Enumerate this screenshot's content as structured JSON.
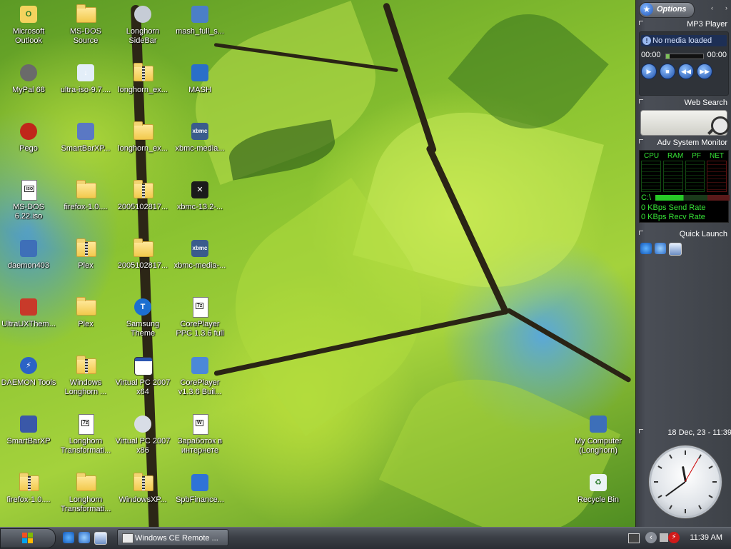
{
  "desktop_icons": [
    {
      "label": "Microsoft Outlook",
      "icon": "outlook-icon"
    },
    {
      "label": "MS-DOS Source",
      "icon": "folder-icon"
    },
    {
      "label": "Longhorn SideBar",
      "icon": "cd-icon"
    },
    {
      "label": "mash_full_s...",
      "icon": "computer-icon"
    },
    {
      "label": "MyPal 68",
      "icon": "raccoon-icon"
    },
    {
      "label": "ultra-iso-9.7....",
      "icon": "installer-icon"
    },
    {
      "label": "longhorn_ex...",
      "icon": "zip-folder-icon"
    },
    {
      "label": "MASH",
      "icon": "mash-icon"
    },
    {
      "label": "Pego",
      "icon": "red-ball-icon"
    },
    {
      "label": "SmartBarXP...",
      "icon": "smartbar-installer-icon"
    },
    {
      "label": "longhorn_ex...",
      "icon": "folder-icon"
    },
    {
      "label": "xbmc-media...",
      "icon": "xbmc-icon"
    },
    {
      "label": "MS-DOS 6.22.iso",
      "icon": "iso-icon"
    },
    {
      "label": "firefox-1.0....",
      "icon": "folder-icon"
    },
    {
      "label": "2005102817...",
      "icon": "zip-folder-icon"
    },
    {
      "label": "xbmc-13.2-...",
      "icon": "xbmc-x-icon"
    },
    {
      "label": "daemon403",
      "icon": "daemon-installer-icon"
    },
    {
      "label": "Plex",
      "icon": "zip-folder-icon"
    },
    {
      "label": "2005102817...",
      "icon": "folder-icon"
    },
    {
      "label": "xbmc-media-...",
      "icon": "xbmc-icon"
    },
    {
      "label": "UltraUXThem...",
      "icon": "ultraux-icon"
    },
    {
      "label": "Plex",
      "icon": "folder-icon"
    },
    {
      "label": "Samsung Theme",
      "icon": "samsung-theme-icon"
    },
    {
      "label": "CorePlayer PPC 1.3.6 full",
      "icon": "7z-icon"
    },
    {
      "label": "DAEMON Tools",
      "icon": "daemon-tools-icon"
    },
    {
      "label": "Windows Longhorn ...",
      "icon": "zip-folder-icon"
    },
    {
      "label": "Virtual PC 2007 x64",
      "icon": "window-icon"
    },
    {
      "label": "CorePlayer v1.3.6 Buil...",
      "icon": "coreplayer-installer-icon"
    },
    {
      "label": "SmartBarXP",
      "icon": "smartbar-icon"
    },
    {
      "label": "Longhorn Transformati...",
      "icon": "7z-icon"
    },
    {
      "label": "Virtual PC 2007 x86",
      "icon": "disc-icon"
    },
    {
      "label": "Заработок в интернете",
      "icon": "word-doc-icon"
    },
    {
      "label": "firefox-1.0....",
      "icon": "zip-folder-icon"
    },
    {
      "label": "Longhorn Transformati...",
      "icon": "folder-icon"
    },
    {
      "label": "WindowsXP...",
      "icon": "zip-folder-icon"
    },
    {
      "label": "SpbFinance...",
      "icon": "spb-installer-icon"
    }
  ],
  "right_icons": [
    {
      "label": "My Computer (Longhorn)",
      "icon": "my-computer-icon"
    },
    {
      "label": "Recycle Bin",
      "icon": "recycle-bin-icon"
    }
  ],
  "sidebar": {
    "options_label": "Options",
    "mp3": {
      "title": "MP3 Player",
      "status": "No media loaded",
      "time_elapsed": "00:00",
      "time_total": "00:00",
      "progress": 0.1
    },
    "search": {
      "title": "Web Search"
    },
    "monitor": {
      "title": "Adv System Monitor",
      "cols": [
        "CPU",
        "RAM",
        "PF",
        "NET"
      ],
      "drive": "C:\\",
      "send": "0 KBps Send Rate",
      "recv": "0 KBps Recv Rate"
    },
    "quick_launch": {
      "title": "Quick Launch"
    },
    "clock": {
      "title": "18 Dec, 23 - 11:39",
      "hour": 11,
      "minute": 39,
      "second": 5
    }
  },
  "taskbar": {
    "task_label": "Windows CE Remote ...",
    "time": "11:39 AM"
  },
  "colors": {
    "accent": "#1e4fa8",
    "taskbar": "#3b3f46",
    "monitor_green": "#36e336"
  }
}
